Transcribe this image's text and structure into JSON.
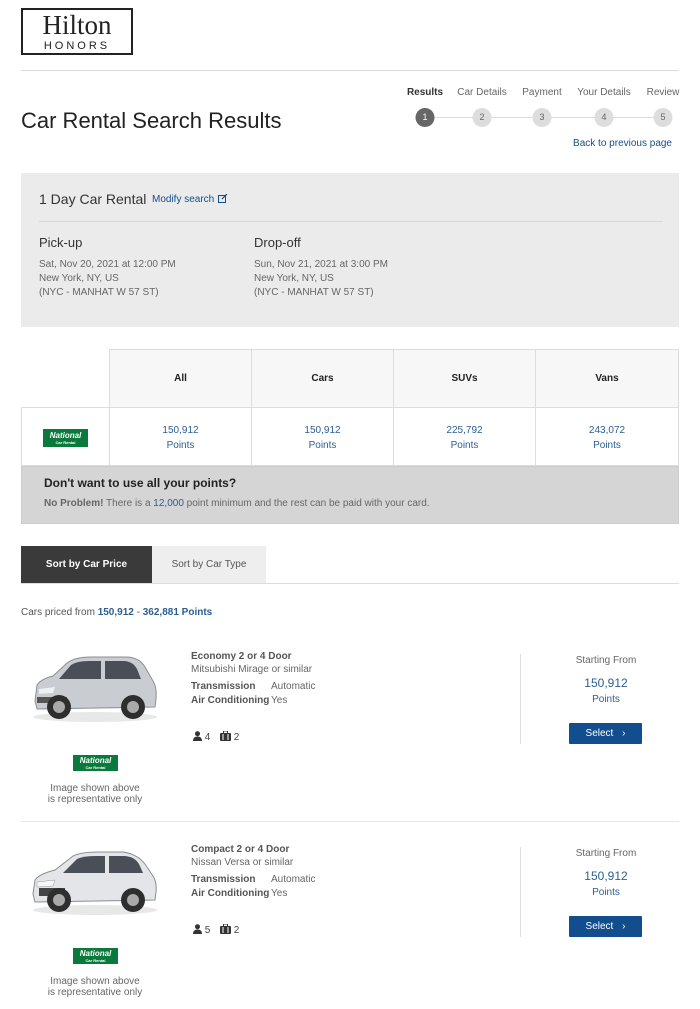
{
  "brand": {
    "line1": "Hilton",
    "line2": "HONORS"
  },
  "page_title": "Car Rental Search Results",
  "steps": [
    {
      "label": "Results",
      "num": "1",
      "active": true
    },
    {
      "label": "Car Details",
      "num": "2",
      "active": false
    },
    {
      "label": "Payment",
      "num": "3",
      "active": false
    },
    {
      "label": "Your Details",
      "num": "4",
      "active": false
    },
    {
      "label": "Review",
      "num": "5",
      "active": false
    }
  ],
  "back_link": "Back to previous page",
  "summary": {
    "rental_title": "1 Day Car Rental",
    "modify_label": "Modify search",
    "pickup": {
      "heading": "Pick-up",
      "datetime": "Sat, Nov 20, 2021 at 12:00 PM",
      "city": "New York, NY, US",
      "location": "(NYC - MANHAT W 57 ST)"
    },
    "dropoff": {
      "heading": "Drop-off",
      "datetime": "Sun, Nov 21, 2021 at 3:00 PM",
      "city": "New York, NY, US",
      "location": "(NYC - MANHAT W 57 ST)"
    }
  },
  "vendor": {
    "name": "National",
    "sub": "Car Rental"
  },
  "price_table": {
    "columns": [
      {
        "header": "All",
        "points": "150,912",
        "unit": "Points"
      },
      {
        "header": "Cars",
        "points": "150,912",
        "unit": "Points"
      },
      {
        "header": "SUVs",
        "points": "225,792",
        "unit": "Points"
      },
      {
        "header": "Vans",
        "points": "243,072",
        "unit": "Points"
      }
    ]
  },
  "promo": {
    "title": "Don't want to use all your points?",
    "bold": "No Problem!",
    "text_before": " There is a ",
    "minimum": "12,000",
    "text_after": " point minimum and the rest can be paid with your card."
  },
  "sort": {
    "by_price": "Sort by Car Price",
    "by_type": "Sort by Car Type"
  },
  "range": {
    "prefix": "Cars priced from ",
    "min": "150,912",
    "sep": " - ",
    "max": "362,881 Points"
  },
  "cars": [
    {
      "type": "Economy 2 or 4 Door",
      "model": "Mitsubishi Mirage or similar",
      "transmission_label": "Transmission",
      "transmission": "Automatic",
      "ac_label": "Air Conditioning",
      "ac": "Yes",
      "passengers": "4",
      "bags": "2",
      "starting_from": "Starting From",
      "points": "150,912",
      "unit": "Points",
      "select_label": "Select",
      "disclaimer_1": "Image shown above",
      "disclaimer_2": "is representative only"
    },
    {
      "type": "Compact 2 or 4 Door",
      "model": "Nissan Versa or similar",
      "transmission_label": "Transmission",
      "transmission": "Automatic",
      "ac_label": "Air Conditioning",
      "ac": "Yes",
      "passengers": "5",
      "bags": "2",
      "starting_from": "Starting From",
      "points": "150,912",
      "unit": "Points",
      "select_label": "Select",
      "disclaimer_1": "Image shown above",
      "disclaimer_2": "is representative only"
    }
  ],
  "colors": {
    "link": "#124d8e",
    "points": "#2c5e91",
    "national_green": "#0a7a3c",
    "active_tab": "#3a3a3a"
  }
}
